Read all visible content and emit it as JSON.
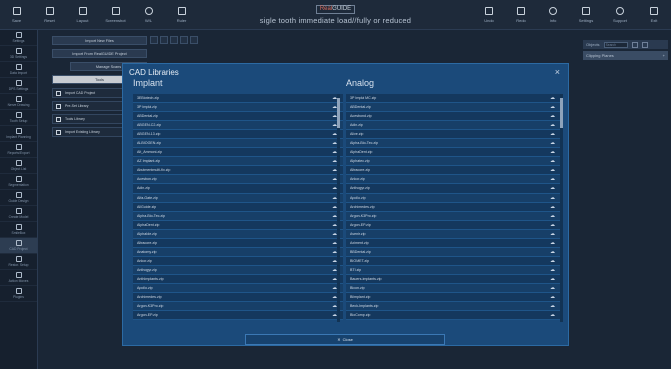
{
  "toolbar": {
    "left": [
      {
        "label": "Save",
        "icon": "save-icon"
      },
      {
        "label": "Reset",
        "icon": "reset-icon"
      },
      {
        "label": "Layout",
        "icon": "layout-icon"
      },
      {
        "label": "Screenshot",
        "icon": "camera-icon"
      },
      {
        "label": "W/L",
        "icon": "contrast-icon"
      },
      {
        "label": "Ruler",
        "icon": "ruler-icon"
      }
    ],
    "logo_prefix": "",
    "logo_red": "Real",
    "logo_rest": "GUIDE",
    "case_title": "sigle tooth immediate load//fully or reduced",
    "right": [
      {
        "label": "Undo",
        "icon": "undo-icon"
      },
      {
        "label": "Redo",
        "icon": "redo-icon"
      },
      {
        "label": "Info",
        "icon": "info-icon"
      },
      {
        "label": "Settings",
        "icon": "gear-icon"
      },
      {
        "label": "Support",
        "icon": "globe-icon"
      },
      {
        "label": "Exit",
        "icon": "exit-icon"
      }
    ]
  },
  "sidebar": {
    "items": [
      {
        "label": "Settings"
      },
      {
        "label": "3D Settings"
      },
      {
        "label": "Data Import"
      },
      {
        "label": "DPS Settings"
      },
      {
        "label": "Nerve Drawing"
      },
      {
        "label": "Tooth Setup"
      },
      {
        "label": "Implant Planning"
      },
      {
        "label": "Reports/Export"
      },
      {
        "label": "Object List"
      },
      {
        "label": "Segmentation"
      },
      {
        "label": "Guide Design"
      },
      {
        "label": "Create Model"
      },
      {
        "label": "SmileBox"
      },
      {
        "label": "CAD Project"
      },
      {
        "label": "Restor. Setup"
      },
      {
        "label": "Action Moves"
      },
      {
        "label": "Plugins"
      }
    ]
  },
  "import_panel": {
    "import_new_files": "Import New Files",
    "import_from_project": "Import From RealGUIDE Project",
    "manage_scans": "Manage Scans",
    "tools": "Tools",
    "rows": [
      {
        "label": "Import CAD Project"
      },
      {
        "label": "Pre-Set Library"
      },
      {
        "label": "Tools Library"
      },
      {
        "label": "Import Existing Library"
      }
    ]
  },
  "right_panel": {
    "objects": "Objects",
    "search_placeholder": "Search",
    "clipping_planes": "Clipping Planes",
    "add": "+"
  },
  "modal": {
    "title": "CAD Libraries",
    "close_x": "×",
    "implant_title": "Implant",
    "analog_title": "Analog",
    "implant_items": [
      "3EBiotech.zip",
      "3P Implá.zip",
      "ABDental.zip",
      "ABGEN-C2.zip",
      "ABGEN-13.zip",
      "ALBIOGEN.zip",
      "Alt_Ammoni.zip",
      "AZ Implant.zip",
      "Abutmentmulti-fix.zip",
      "Acesbon.zip",
      "Adin.zip",
      "Alfa-Gate.zip",
      "AllGuide.zip",
      "Alpha-Bio-Tec.zip",
      "AlphaDent.zip",
      "AlphaIde.zip",
      "Altracore.zip",
      "Anatomy.zip",
      "Ankor.zip",
      "Anthogyr.zip",
      "AnthImplants.zip",
      "Apollo.zip",
      "Archimedes.zip",
      "Argon-K3Pro.zip",
      "Argon-EP.zip"
    ],
    "analog_items": [
      "3P Implá MC.zip",
      "ABDental.zip",
      "Acesbond.zip",
      "Adin.zip",
      "Alive.zip",
      "Alpha-Bio-Tec.zip",
      "AlphaDent.zip",
      "Alphatec.zip",
      "Altracore.zip",
      "Ankor.zip",
      "Anthogyr.zip",
      "Apollo.zip",
      "Archimedes.zip",
      "Argon-K3Pro.zip",
      "Argon-EP.zip",
      "Avenir.zip",
      "Aximent.zip",
      "BBDental.zip",
      "BIOMET.zip",
      "BTI.zip",
      "Bauers-implants.zip",
      "Bicon.zip",
      "Biimplant.zip",
      "Beck-Implants.zip",
      "BioComp.zip"
    ],
    "close_button": "Close"
  }
}
